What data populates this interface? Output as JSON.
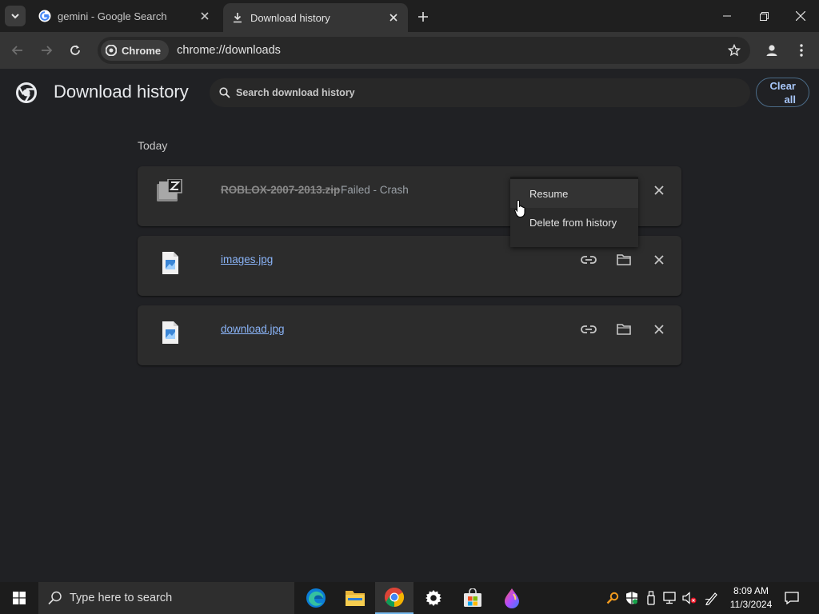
{
  "tabs": [
    {
      "title": "gemini - Google Search",
      "active": false,
      "icon": "google-g-icon"
    },
    {
      "title": "Download history",
      "active": true,
      "icon": "download-icon"
    }
  ],
  "toolbar": {
    "chip_label": "Chrome",
    "url": "chrome://downloads"
  },
  "page": {
    "title": "Download history",
    "search_placeholder": "Search download history",
    "clear_all_line1": "Clear",
    "clear_all_line2": "all",
    "section": "Today"
  },
  "downloads": [
    {
      "name": "ROBLOX-2007-2013.zip",
      "status": "Failed - Crash",
      "state": "failed",
      "icon": "zip-file-icon"
    },
    {
      "name": "images.jpg",
      "status": "",
      "state": "complete",
      "icon": "image-file-icon"
    },
    {
      "name": "download.jpg",
      "status": "",
      "state": "complete",
      "icon": "image-file-icon"
    }
  ],
  "context_menu": {
    "items": [
      "Resume",
      "Delete from history"
    ]
  },
  "taskbar": {
    "search_placeholder": "Type here to search",
    "apps": [
      "edge-icon",
      "file-explorer-icon",
      "chrome-icon",
      "settings-icon",
      "microsoft-store-icon",
      "paint-icon"
    ],
    "time": "8:09 AM",
    "date": "11/3/2024"
  },
  "colors": {
    "page_bg": "#202124",
    "card_bg": "#2c2c2c",
    "link": "#8ab4f8",
    "accent": "#a8c7fa"
  }
}
